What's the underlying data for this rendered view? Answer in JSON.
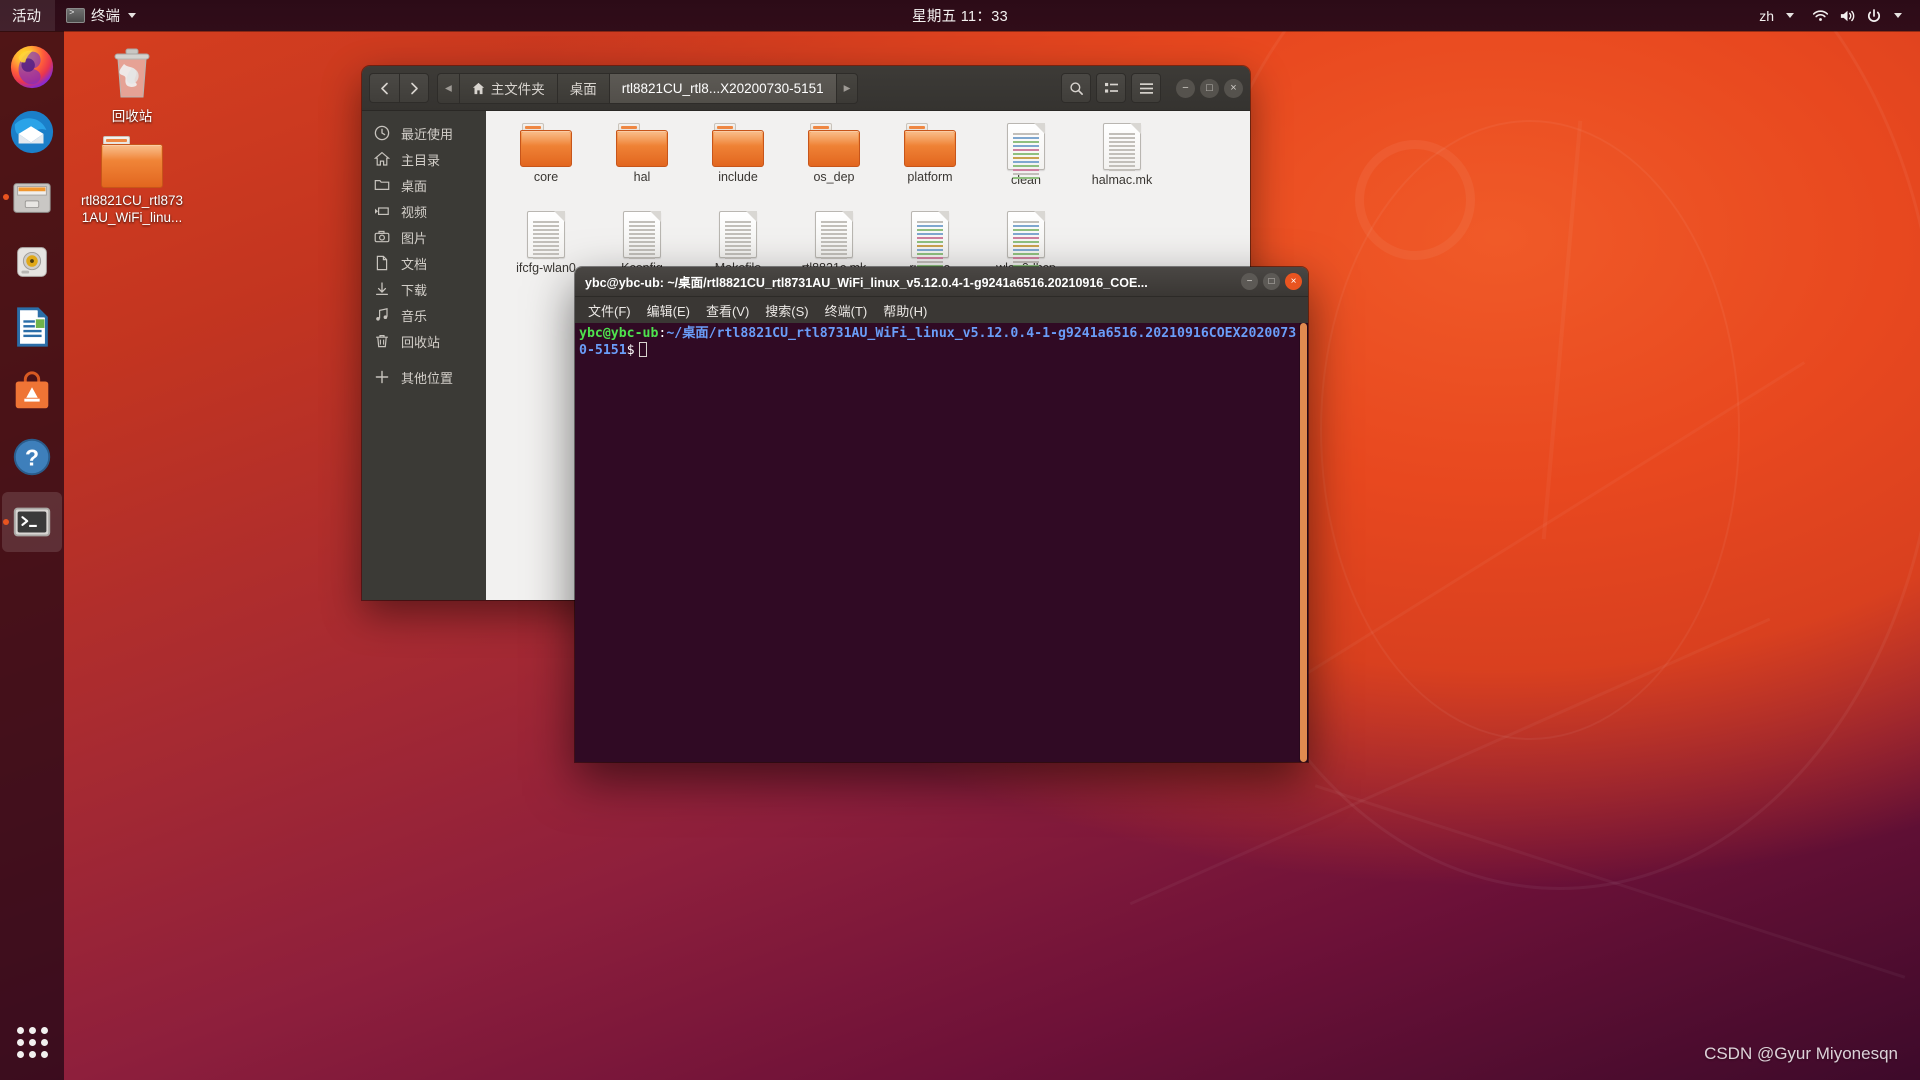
{
  "topbar": {
    "activities": "活动",
    "app_menu": "终端",
    "clock": "星期五 11：33",
    "language": "zh",
    "icons": [
      "wifi-icon",
      "volume-icon",
      "power-icon"
    ]
  },
  "dock": {
    "items": [
      {
        "name": "firefox",
        "label": "Firefox",
        "running": false
      },
      {
        "name": "thunderbird",
        "label": "Thunderbird",
        "running": false
      },
      {
        "name": "files",
        "label": "Files",
        "running": true
      },
      {
        "name": "rhythmbox",
        "label": "Rhythmbox",
        "running": false
      },
      {
        "name": "libreoffice-writer",
        "label": "LibreOffice Writer",
        "running": false
      },
      {
        "name": "ubuntu-software",
        "label": "Ubuntu Software",
        "running": false
      },
      {
        "name": "help",
        "label": "Help",
        "running": false
      },
      {
        "name": "terminal",
        "label": "终端",
        "running": true,
        "active": true
      }
    ],
    "show_applications": "显示应用程序"
  },
  "desktop": {
    "icons": [
      {
        "type": "trash",
        "label": "回收站"
      },
      {
        "type": "folder",
        "label": "rtl8821CU_rtl8731AU_WiFi_linu..."
      }
    ]
  },
  "nautilus": {
    "nav": {
      "back": "‹",
      "forward": "›"
    },
    "breadcrumb": [
      {
        "label": "主文件夹",
        "icon": "home-icon",
        "current": false
      },
      {
        "label": "桌面",
        "icon": "",
        "current": false
      },
      {
        "label": "rtl8821CU_rtl8...X20200730-5151",
        "icon": "",
        "current": true
      }
    ],
    "toolbar": {
      "search": "search-icon",
      "view_toggle": "list-view-icon",
      "menu": "hamburger-menu-icon"
    },
    "window_buttons": {
      "minimize": "−",
      "maximize": "□",
      "close": "×"
    },
    "sidebar": [
      {
        "icon": "clock-icon",
        "label": "最近使用"
      },
      {
        "icon": "home-icon",
        "label": "主目录"
      },
      {
        "icon": "folder-icon",
        "label": "桌面"
      },
      {
        "icon": "video-icon",
        "label": "视频"
      },
      {
        "icon": "camera-icon",
        "label": "图片"
      },
      {
        "icon": "document-icon",
        "label": "文档"
      },
      {
        "icon": "download-icon",
        "label": "下载"
      },
      {
        "icon": "music-icon",
        "label": "音乐"
      },
      {
        "icon": "trash-icon",
        "label": "回收站"
      },
      {
        "icon": "plus-icon",
        "label": "其他位置"
      }
    ],
    "files": [
      {
        "name": "core",
        "type": "folder"
      },
      {
        "name": "hal",
        "type": "folder"
      },
      {
        "name": "include",
        "type": "folder"
      },
      {
        "name": "os_dep",
        "type": "folder"
      },
      {
        "name": "platform",
        "type": "folder"
      },
      {
        "name": "clean",
        "type": "script"
      },
      {
        "name": "halmac.mk",
        "type": "file"
      },
      {
        "name": "ifcfg-wlan0",
        "type": "file"
      },
      {
        "name": "Kconfig",
        "type": "file"
      },
      {
        "name": "Makefile",
        "type": "file"
      },
      {
        "name": "rtl8821c.mk",
        "type": "file"
      },
      {
        "name": "runwpa",
        "type": "script"
      },
      {
        "name": "wlan0dhcp",
        "type": "script"
      }
    ]
  },
  "terminal": {
    "title": "ybc@ybc-ub: ~/桌面/rtl8821CU_rtl8731AU_WiFi_linux_v5.12.0.4-1-g9241a6516.20210916_COE...",
    "window_buttons": {
      "minimize": "−",
      "maximize": "□",
      "close": "×"
    },
    "menu": [
      "文件(F)",
      "编辑(E)",
      "查看(V)",
      "搜索(S)",
      "终端(T)",
      "帮助(H)"
    ],
    "prompt": {
      "user_host": "ybc@ybc-ub",
      "colon": ":",
      "path": "~/桌面/rtl8821CU_rtl8731AU_WiFi_linux_v5.12.0.4-1-g9241a6516.20210916COEX20200730-5151",
      "dollar": "$"
    }
  },
  "watermark": "CSDN @Gyur Miyonesqn",
  "colors": {
    "ubuntu_orange": "#e95420",
    "topbar_bg": "#2b0a16",
    "terminal_bg": "#300a24",
    "prompt_user": "#4ee24e",
    "prompt_path": "#6a9df8",
    "nautilus_header": "#3a3734",
    "nautilus_sidebar": "#3b3a36",
    "file_area_bg": "#f2f1f0"
  }
}
